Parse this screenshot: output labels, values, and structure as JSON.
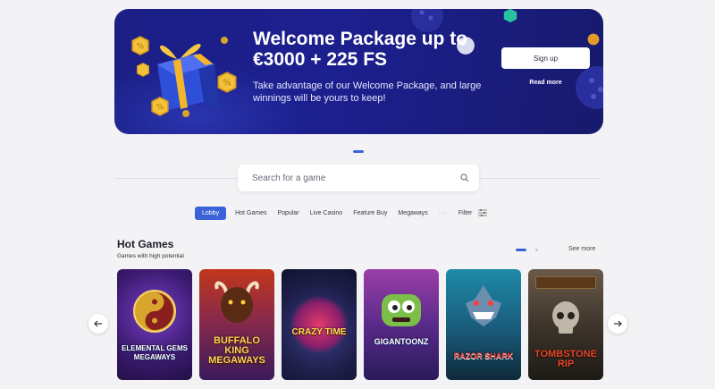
{
  "banner": {
    "title_line1": "Welcome Package up to",
    "title_line2": "€3000 + 225 FS",
    "description": "Take advantage of our Welcome Package, and large winnings will be yours to keep!",
    "signup_label": "Sign up",
    "read_more_label": "Read more"
  },
  "search": {
    "placeholder": "Search for a game"
  },
  "tabs": [
    {
      "label": "Lobby",
      "active": true
    },
    {
      "label": "Hot Games"
    },
    {
      "label": "Popular"
    },
    {
      "label": "Live Casino"
    },
    {
      "label": "Feature Buy"
    },
    {
      "label": "Megaways"
    },
    {
      "label": "···"
    },
    {
      "label": "Filter"
    }
  ],
  "section": {
    "title": "Hot Games",
    "subtitle": "Games with high potential",
    "see_more": "See more"
  },
  "games": [
    {
      "name": "ELEMENTAL GEMS MEGAWAYS"
    },
    {
      "name": "BUFFALO KING MEGAWAYS"
    },
    {
      "name": "CRAZY TIME"
    },
    {
      "name": "GIGANTOONZ"
    },
    {
      "name": "RAZOR SHARK"
    },
    {
      "name": "TOMBSTONE RIP"
    }
  ],
  "colors": {
    "accent": "#3b63d9",
    "banner_bg": "#1b1f86"
  }
}
